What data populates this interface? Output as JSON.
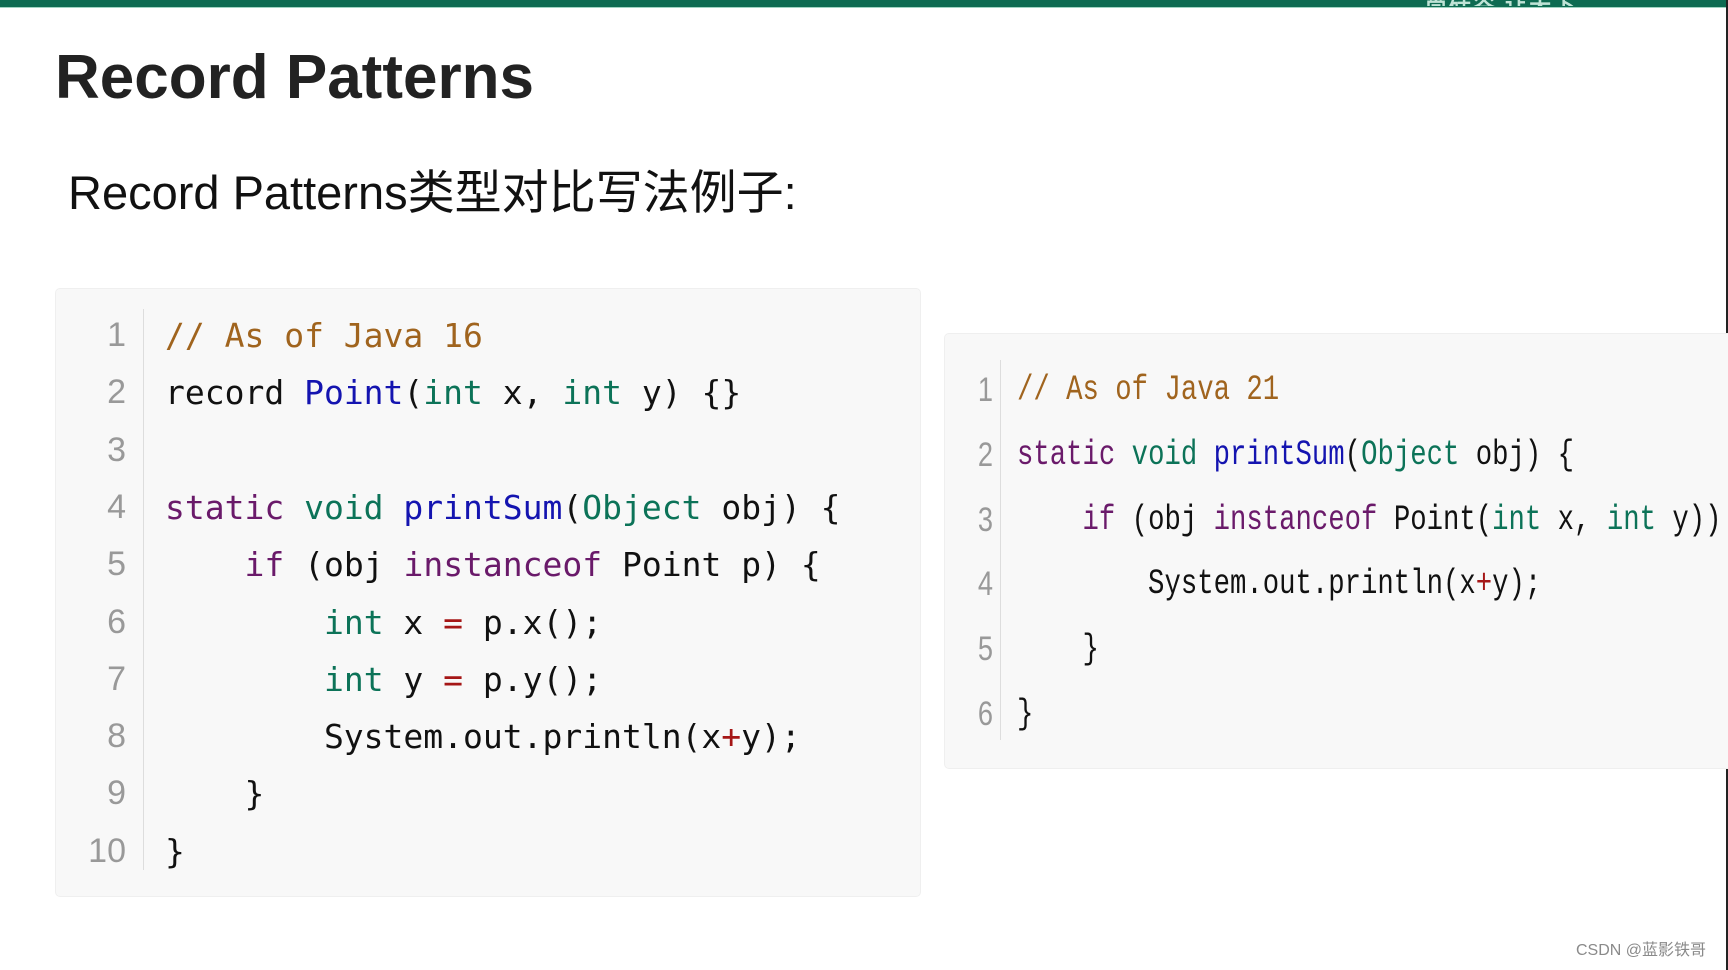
{
  "header": {
    "brand_color": "#0e6b52",
    "ghost_text": "尚硅谷 让天下"
  },
  "slide": {
    "title": "Record Patterns",
    "subtitle": "Record Patterns类型对比写法例子:"
  },
  "code_blocks": [
    {
      "label": "java16-example",
      "lines": [
        {
          "number": "1",
          "tokens": [
            {
              "t": "// As of Java 16",
              "k": "comment"
            }
          ]
        },
        {
          "number": "2",
          "tokens": [
            {
              "t": "record ",
              "k": "plain"
            },
            {
              "t": "Point",
              "k": "def"
            },
            {
              "t": "(",
              "k": "plain"
            },
            {
              "t": "int",
              "k": "type"
            },
            {
              "t": " x, ",
              "k": "plain"
            },
            {
              "t": "int",
              "k": "type"
            },
            {
              "t": " y) {}",
              "k": "plain"
            }
          ]
        },
        {
          "number": "3",
          "tokens": []
        },
        {
          "number": "4",
          "tokens": [
            {
              "t": "static ",
              "k": "keyword"
            },
            {
              "t": "void ",
              "k": "type"
            },
            {
              "t": "printSum",
              "k": "def"
            },
            {
              "t": "(",
              "k": "plain"
            },
            {
              "t": "Object",
              "k": "type"
            },
            {
              "t": " obj) {",
              "k": "plain"
            }
          ]
        },
        {
          "number": "5",
          "tokens": [
            {
              "t": "    ",
              "k": "plain"
            },
            {
              "t": "if",
              "k": "keyword"
            },
            {
              "t": " (obj ",
              "k": "plain"
            },
            {
              "t": "instanceof",
              "k": "keyword"
            },
            {
              "t": " Point p) {",
              "k": "plain"
            }
          ]
        },
        {
          "number": "6",
          "tokens": [
            {
              "t": "        ",
              "k": "plain"
            },
            {
              "t": "int",
              "k": "type"
            },
            {
              "t": " x ",
              "k": "plain"
            },
            {
              "t": "=",
              "k": "op"
            },
            {
              "t": " p.x();",
              "k": "plain"
            }
          ]
        },
        {
          "number": "7",
          "tokens": [
            {
              "t": "        ",
              "k": "plain"
            },
            {
              "t": "int",
              "k": "type"
            },
            {
              "t": " y ",
              "k": "plain"
            },
            {
              "t": "=",
              "k": "op"
            },
            {
              "t": " p.y();",
              "k": "plain"
            }
          ]
        },
        {
          "number": "8",
          "tokens": [
            {
              "t": "        System.out.println(x",
              "k": "plain"
            },
            {
              "t": "+",
              "k": "op"
            },
            {
              "t": "y);",
              "k": "plain"
            }
          ]
        },
        {
          "number": "9",
          "tokens": [
            {
              "t": "    }",
              "k": "plain"
            }
          ]
        },
        {
          "number": "10",
          "tokens": [
            {
              "t": "}",
              "k": "plain"
            }
          ]
        }
      ]
    },
    {
      "label": "java21-example",
      "lines": [
        {
          "number": "1",
          "tokens": [
            {
              "t": "// As of Java 21",
              "k": "comment"
            }
          ]
        },
        {
          "number": "2",
          "tokens": [
            {
              "t": "static ",
              "k": "keyword"
            },
            {
              "t": "void ",
              "k": "type"
            },
            {
              "t": "printSum",
              "k": "def"
            },
            {
              "t": "(",
              "k": "plain"
            },
            {
              "t": "Object",
              "k": "type"
            },
            {
              "t": " obj) {",
              "k": "plain"
            }
          ]
        },
        {
          "number": "3",
          "tokens": [
            {
              "t": "    ",
              "k": "plain"
            },
            {
              "t": "if",
              "k": "keyword"
            },
            {
              "t": " (obj ",
              "k": "plain"
            },
            {
              "t": "instanceof",
              "k": "keyword"
            },
            {
              "t": " Point(",
              "k": "plain"
            },
            {
              "t": "int",
              "k": "type"
            },
            {
              "t": " x, ",
              "k": "plain"
            },
            {
              "t": "int",
              "k": "type"
            },
            {
              "t": " y)) {",
              "k": "plain"
            }
          ]
        },
        {
          "number": "4",
          "tokens": [
            {
              "t": "        System.out.println(x",
              "k": "plain"
            },
            {
              "t": "+",
              "k": "op"
            },
            {
              "t": "y);",
              "k": "plain"
            }
          ]
        },
        {
          "number": "5",
          "tokens": [
            {
              "t": "    }",
              "k": "plain"
            }
          ]
        },
        {
          "number": "6",
          "tokens": [
            {
              "t": "}",
              "k": "plain"
            }
          ]
        }
      ]
    }
  ],
  "token_colors": {
    "comment": "#a0641e",
    "keyword": "#6a1a6a",
    "type": "#0c7358",
    "def": "#1414b0",
    "op": "#a51616",
    "plain": "#111111"
  },
  "watermark": "CSDN @蓝影铁哥"
}
